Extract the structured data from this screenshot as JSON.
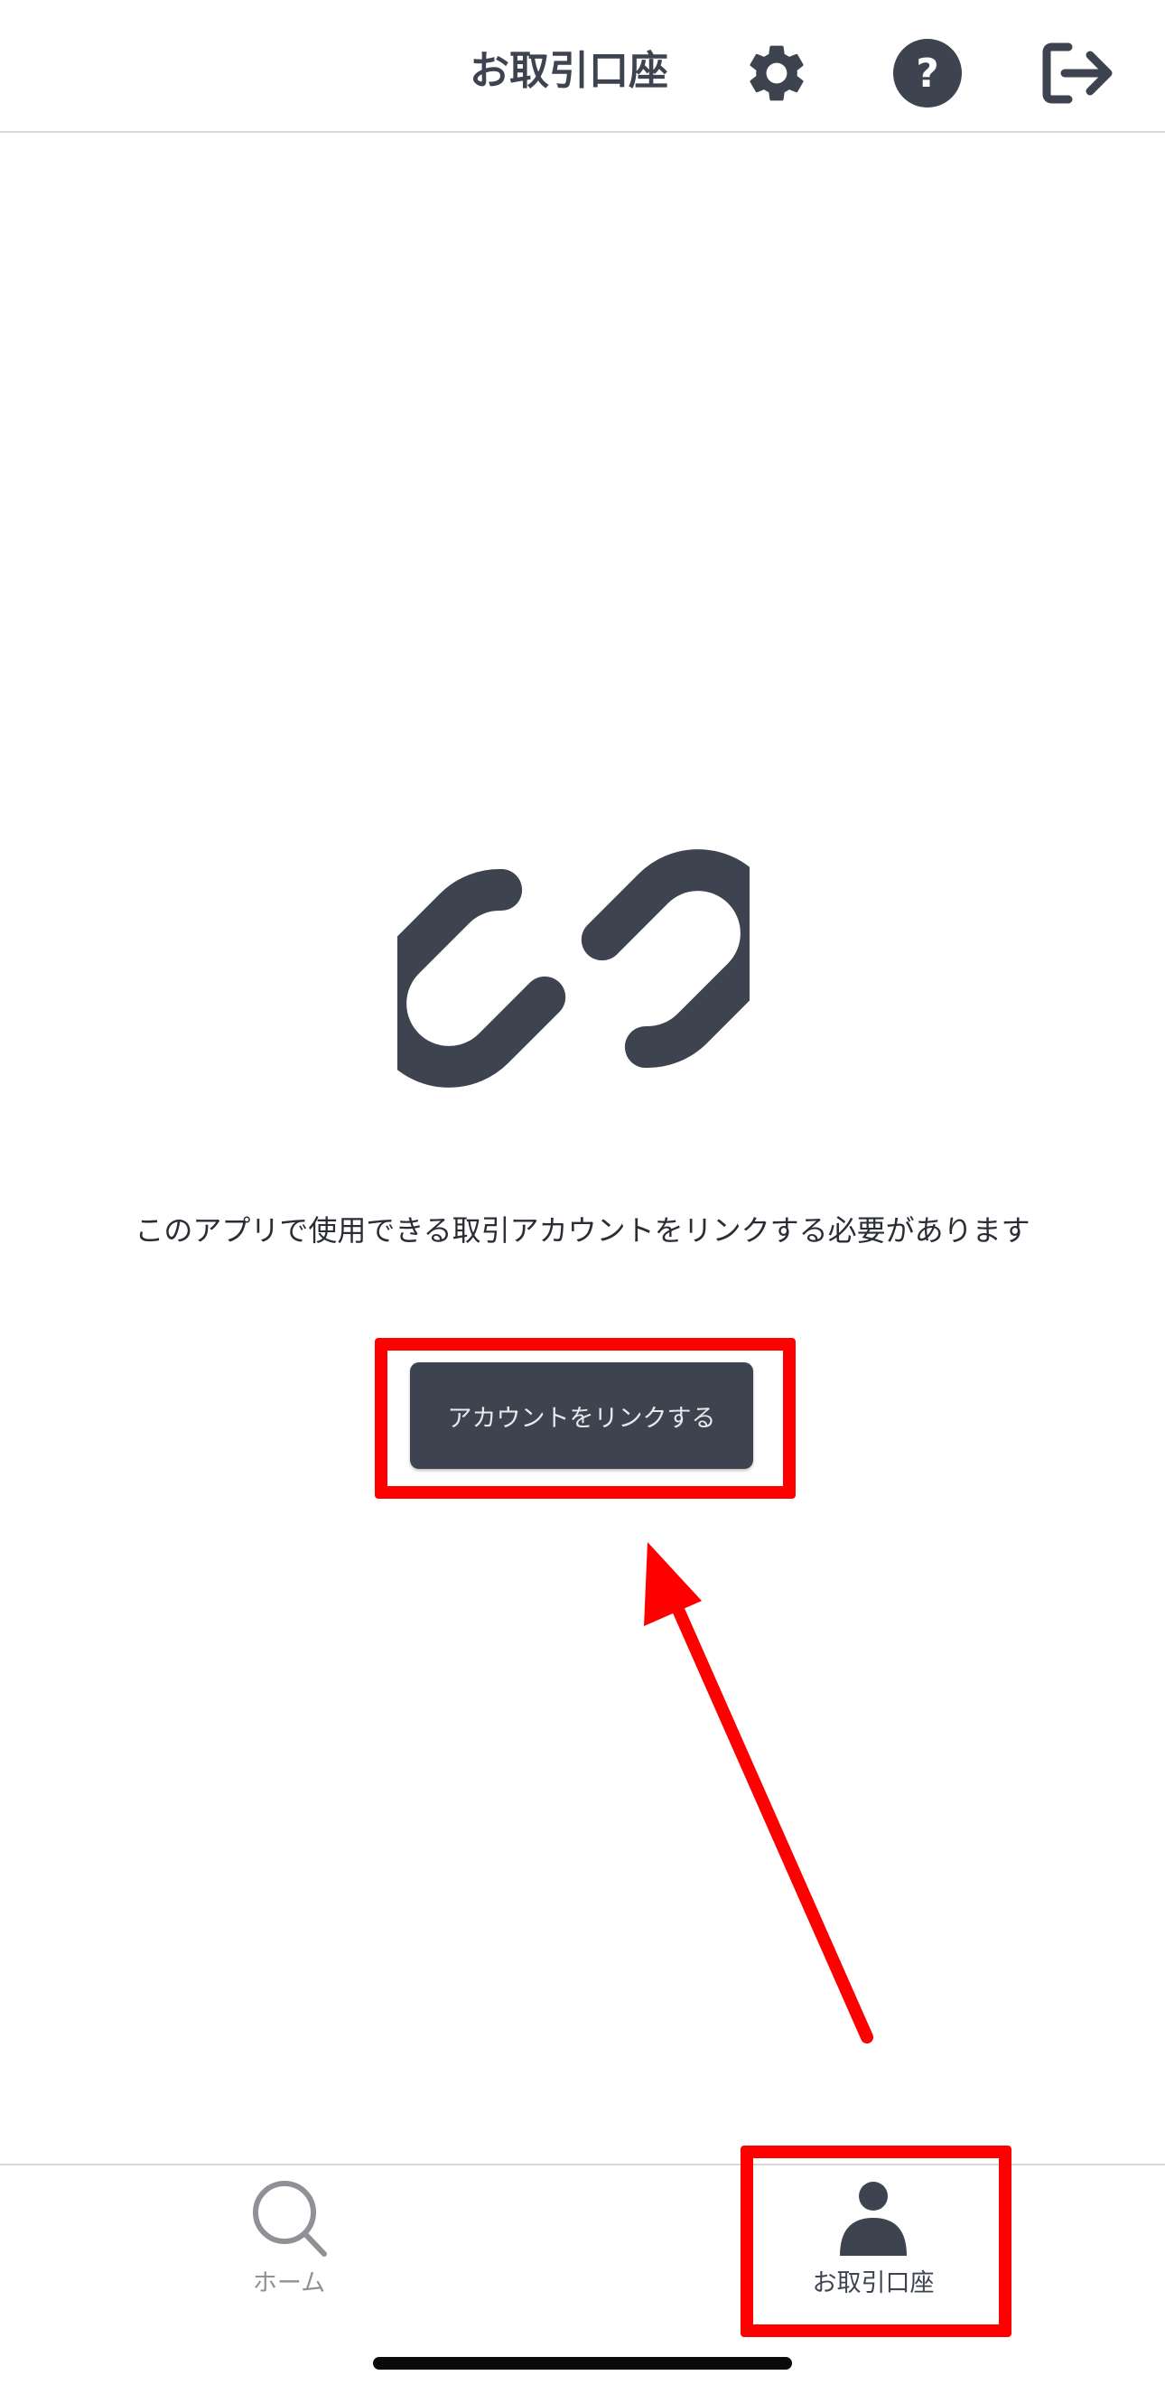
{
  "header": {
    "title": "お取引口座",
    "icons": [
      "gear-icon",
      "help-circle-icon",
      "logout-icon"
    ]
  },
  "main": {
    "illustration_icon": "link-icon",
    "message": "このアプリで使用できる取引アカウントをリンクする必要があります",
    "link_button_label": "アカウントをリンクする"
  },
  "tabbar": {
    "tabs": [
      {
        "label": "ホーム",
        "icon": "search-icon",
        "active": false
      },
      {
        "label": "お取引口座",
        "icon": "person-icon",
        "active": true
      }
    ]
  },
  "colors": {
    "primary_dark": "#3e4350",
    "inactive_gray": "#8f9196",
    "annotation_red": "#ff0000"
  }
}
